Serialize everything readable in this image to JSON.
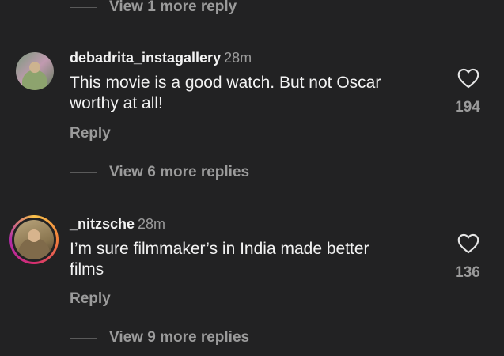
{
  "top": {
    "more_replies": "View 1 more reply"
  },
  "comments": [
    {
      "username": "debadrita_instagallery",
      "time": "28m",
      "text_line1": "This movie is a good watch. But not Oscar",
      "text_line2": "worthy at all!",
      "reply_label": "Reply",
      "likes": "194",
      "more_replies": "View 6 more replies"
    },
    {
      "username": "_nitzsche",
      "time": "28m",
      "text_line1": "I’m sure filmmaker’s in India made better",
      "text_line2": "films",
      "reply_label": "Reply",
      "likes": "136",
      "more_replies": "View 9 more replies"
    }
  ],
  "icons": {
    "like": "heart-icon"
  }
}
